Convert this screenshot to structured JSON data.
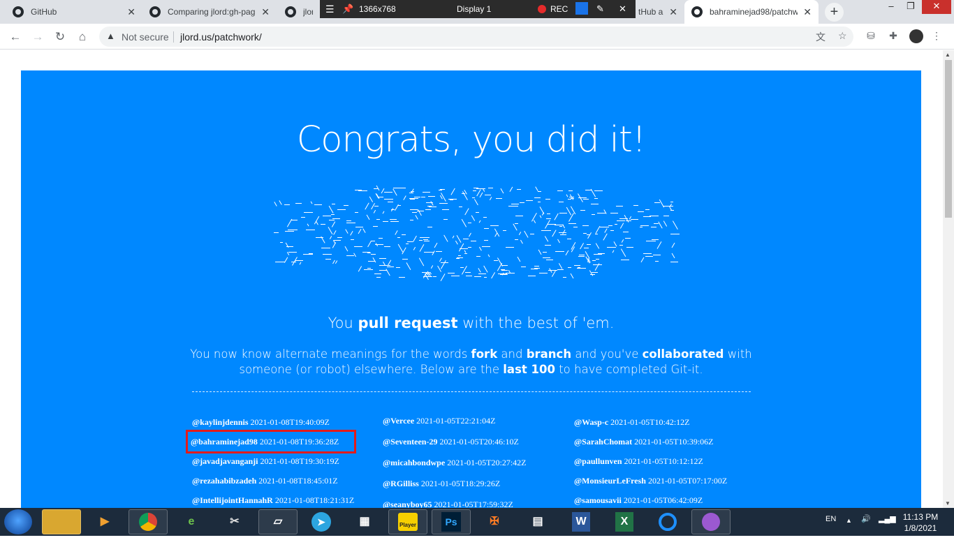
{
  "browser": {
    "tabs": [
      {
        "title": "GitHub"
      },
      {
        "title": "Comparing jlord:gh-pag"
      },
      {
        "title": "jlor"
      },
      {
        "title": "tHub a"
      },
      {
        "title": "bahraminejad98/patchw"
      }
    ],
    "new_tab": "+",
    "address": {
      "security": "Not secure",
      "url": "jlord.us/patchwork/"
    }
  },
  "recorder": {
    "resolution": "1366x768",
    "display": "Display 1",
    "rec": "REC"
  },
  "page": {
    "headline": "Congrats, you did it!",
    "tagline": {
      "pre": "You ",
      "bold": "pull request",
      "post": " with the best of 'em."
    },
    "desc": {
      "p1": "You now know alternate meanings for the words ",
      "b1": "fork",
      "p2": " and ",
      "b2": "branch",
      "p3": " and you've ",
      "b3": "collaborated",
      "p4": " with someone (or robot) elsewhere. Below are the ",
      "b4": "last 100",
      "p5": " to have completed Git-it."
    },
    "columns": [
      [
        {
          "user": "@kaylinjdennis",
          "time": "2021-01-08T19:40:09Z"
        },
        {
          "user": "@bahraminejad98",
          "time": "2021-01-08T19:36:28Z",
          "highlighted": true
        },
        {
          "user": "@javadjavanganji",
          "time": "2021-01-08T19:30:19Z"
        },
        {
          "user": "@rezahabibzadeh",
          "time": "2021-01-08T18:45:01Z"
        },
        {
          "user": "@IntellijointHannahR",
          "time": "2021-01-08T18:21:31Z"
        }
      ],
      [
        {
          "user": "@Vercee",
          "time": "2021-01-05T22:21:04Z"
        },
        {
          "user": "@Seventeen-29",
          "time": "2021-01-05T20:46:10Z"
        },
        {
          "user": "@micahbondwpe",
          "time": "2021-01-05T20:27:42Z"
        },
        {
          "user": "@RGilliss",
          "time": "2021-01-05T18:29:26Z"
        },
        {
          "user": "@seanyboy65",
          "time": "2021-01-05T17:59:32Z"
        }
      ],
      [
        {
          "user": "@Wasp-c",
          "time": "2021-01-05T10:42:12Z"
        },
        {
          "user": "@SarahChomat",
          "time": "2021-01-05T10:39:06Z"
        },
        {
          "user": "@paullunven",
          "time": "2021-01-05T10:12:12Z"
        },
        {
          "user": "@MonsieurLeFresh",
          "time": "2021-01-05T07:17:00Z"
        },
        {
          "user": "@samousavii",
          "time": "2021-01-05T06:42:09Z"
        }
      ]
    ]
  },
  "taskbar": {
    "apps": [
      "file-explorer",
      "media-player",
      "chrome",
      "internet-explorer",
      "paint",
      "notes",
      "telegram",
      "calculator",
      "player",
      "photoshop",
      "xampp",
      "control-panel",
      "word",
      "excel",
      "browser",
      "github-desktop"
    ],
    "labels": {
      "ps": "Ps",
      "player": "Player",
      "word": "W",
      "excel": "X"
    },
    "lang": "EN",
    "time": "11:13 PM",
    "date": "1/8/2021"
  },
  "colors": {
    "accent": "#0088ff",
    "highlight_box": "#e31b1b"
  }
}
